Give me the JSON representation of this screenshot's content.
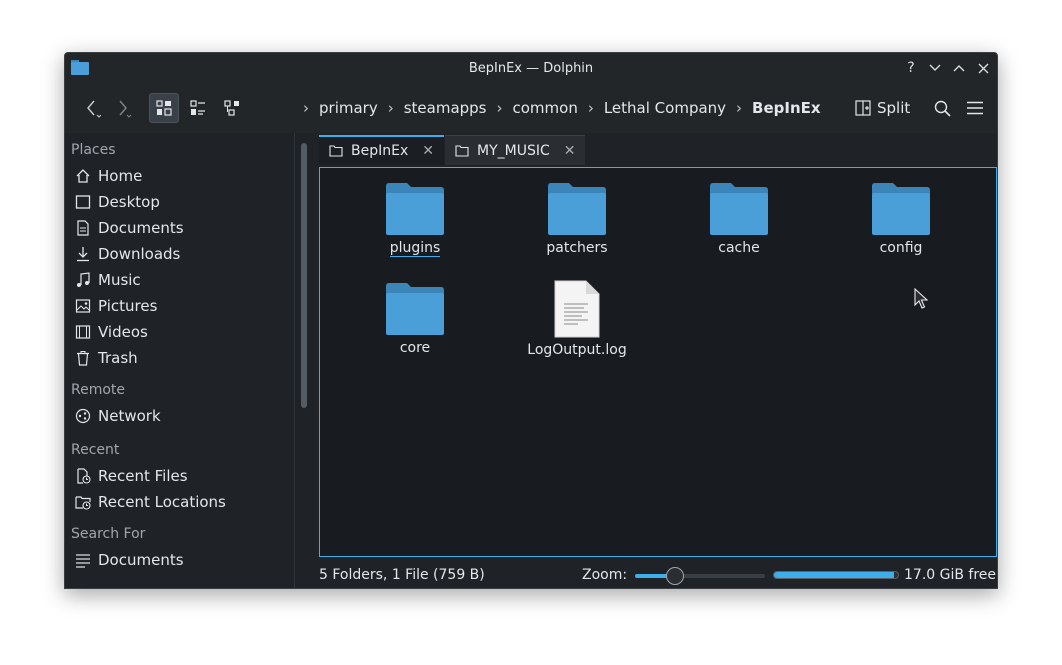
{
  "window": {
    "title": "BepInEx — Dolphin"
  },
  "toolbar": {
    "breadcrumb": [
      "primary",
      "steamapps",
      "common",
      "Lethal Company",
      "BepInEx"
    ],
    "split_label": "Split"
  },
  "sidebar": {
    "sections": [
      {
        "title": "Places",
        "items": [
          {
            "label": "Home",
            "icon": "home-icon"
          },
          {
            "label": "Desktop",
            "icon": "desktop-icon"
          },
          {
            "label": "Documents",
            "icon": "documents-icon"
          },
          {
            "label": "Downloads",
            "icon": "downloads-icon"
          },
          {
            "label": "Music",
            "icon": "music-icon"
          },
          {
            "label": "Pictures",
            "icon": "pictures-icon"
          },
          {
            "label": "Videos",
            "icon": "videos-icon"
          },
          {
            "label": "Trash",
            "icon": "trash-icon"
          }
        ]
      },
      {
        "title": "Remote",
        "items": [
          {
            "label": "Network",
            "icon": "network-icon"
          }
        ]
      },
      {
        "title": "Recent",
        "items": [
          {
            "label": "Recent Files",
            "icon": "recent-files-icon"
          },
          {
            "label": "Recent Locations",
            "icon": "recent-locations-icon"
          }
        ]
      },
      {
        "title": "Search For",
        "items": [
          {
            "label": "Documents",
            "icon": "search-documents-icon"
          }
        ]
      }
    ]
  },
  "tabs": [
    {
      "label": "BepInEx",
      "active": true
    },
    {
      "label": "MY_MUSIC",
      "active": false
    }
  ],
  "files": [
    {
      "name": "plugins",
      "type": "folder",
      "selected": true
    },
    {
      "name": "patchers",
      "type": "folder"
    },
    {
      "name": "cache",
      "type": "folder"
    },
    {
      "name": "config",
      "type": "folder"
    },
    {
      "name": "core",
      "type": "folder"
    },
    {
      "name": "LogOutput.log",
      "type": "text-file"
    }
  ],
  "status": {
    "summary": "5 Folders, 1 File (759 B)",
    "zoom_label": "Zoom:",
    "zoom_level": 0.28,
    "space_used_fraction": 0.97,
    "free_space": "17.0 GiB free"
  },
  "colors": {
    "accent": "#3daee9",
    "folder": "#4a9fd8",
    "folder_tab": "#3b85b8"
  }
}
